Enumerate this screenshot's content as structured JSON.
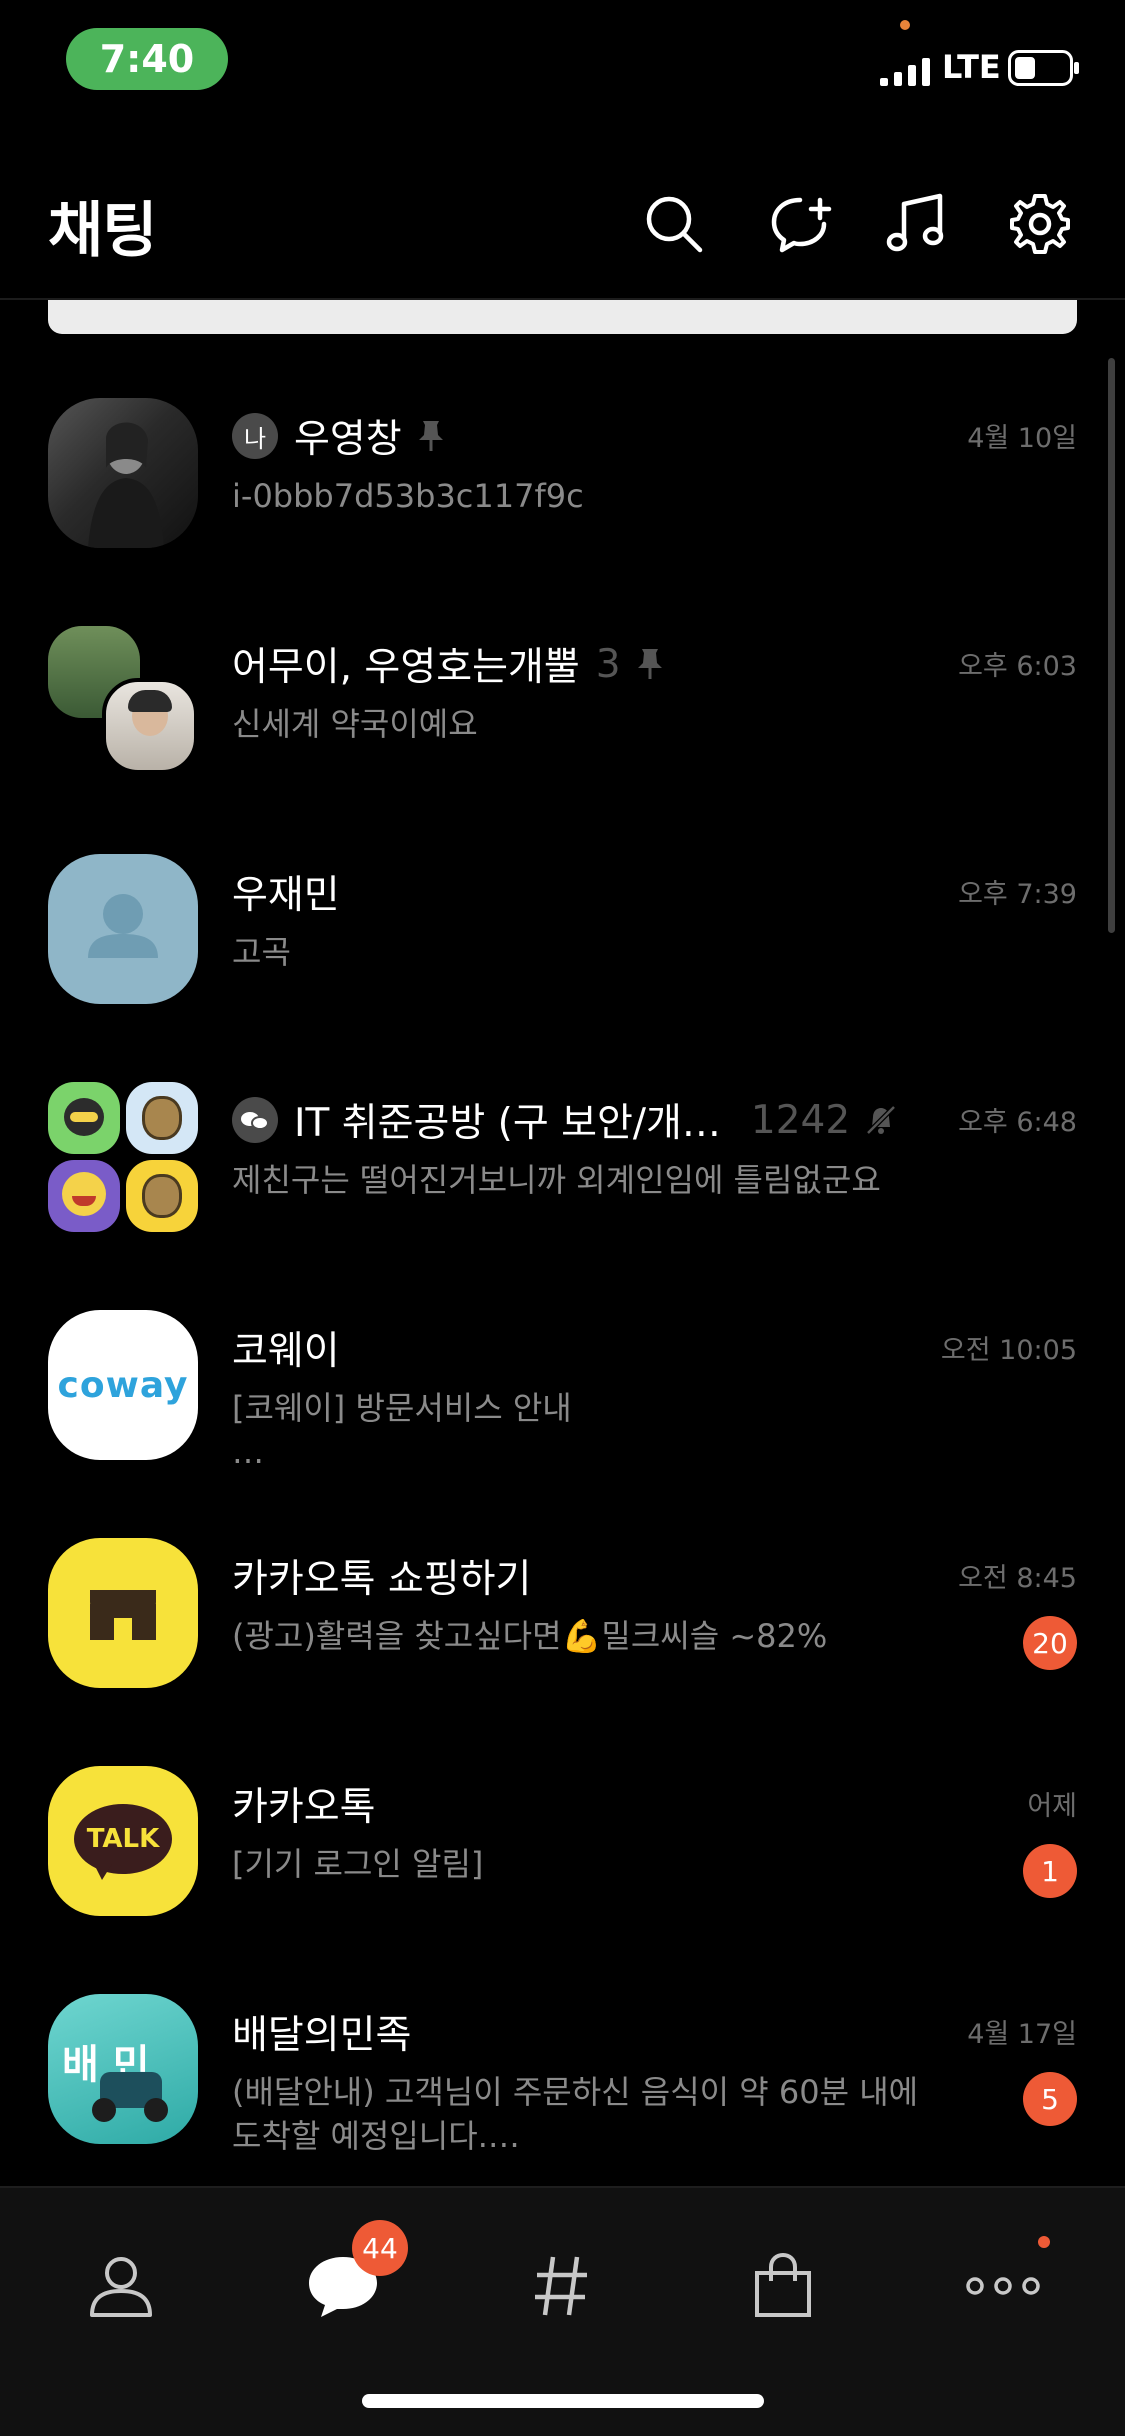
{
  "status_bar": {
    "time": "7:40",
    "network": "LTE"
  },
  "header": {
    "title": "채팅"
  },
  "colors": {
    "accent": "#ee5a36",
    "time_pill": "#4cb45a",
    "kakao_yellow": "#f7e23a"
  },
  "chats": [
    {
      "name": "우영창",
      "preview": "i-0bbb7d53b3c117f9c",
      "time": "4월 10일",
      "me_badge": "나",
      "pinned": true
    },
    {
      "name": "어무이, 우영호는개뿔",
      "count": "3",
      "preview": "신세계 약국이예요",
      "time": "오후 6:03",
      "pinned": true
    },
    {
      "name": "우재민",
      "preview": "고곡",
      "time": "오후 7:39"
    },
    {
      "name": "IT 취준공방 (구 보안/개…",
      "count": "1242",
      "preview": "제친구는 떨어진거보니까 외계인임에 틀림없군요",
      "time": "오후 6:48",
      "muted": true
    },
    {
      "name": "코웨이",
      "preview": "[코웨이] 방문서비스 안내\n…",
      "time": "오전 10:05",
      "avatar_text": "coway"
    },
    {
      "name": "카카오톡 쇼핑하기",
      "preview": "(광고)활력을 찾고싶다면💪밀크씨슬 ~82%",
      "time": "오전 8:45",
      "unread": "20"
    },
    {
      "name": "카카오톡",
      "preview": "[기기 로그인 알림]",
      "time": "어제",
      "unread": "1",
      "avatar_text": "TALK"
    },
    {
      "name": "배달의민족",
      "preview": "(배달안내) 고객님이 주문하신 음식이 약 60분 내에\n도착할 예정입니다.…",
      "time": "4월 17일",
      "unread": "5",
      "avatar_text": "배 민"
    }
  ],
  "tabbar": {
    "items": [
      {
        "icon": "person-icon"
      },
      {
        "icon": "chat-bubble-icon",
        "badge": "44"
      },
      {
        "icon": "hashtag-icon"
      },
      {
        "icon": "shopping-bag-icon"
      },
      {
        "icon": "more-dots-icon"
      }
    ]
  }
}
